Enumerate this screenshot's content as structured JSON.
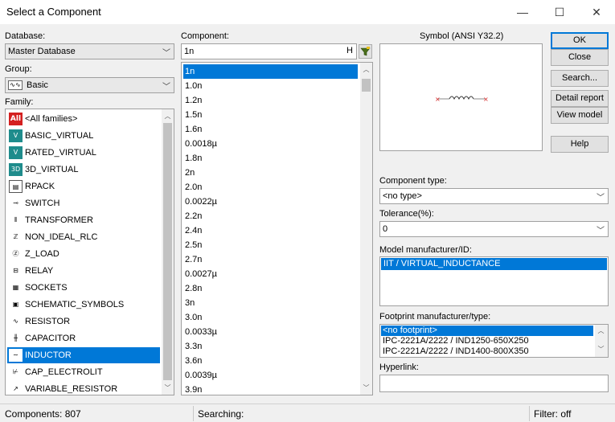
{
  "window": {
    "title": "Select a Component",
    "minimize": "—",
    "maximize": "☐",
    "close": "✕"
  },
  "database": {
    "label": "Database:",
    "value": "Master Database"
  },
  "group": {
    "label": "Group:",
    "value": "Basic"
  },
  "family": {
    "label": "Family:",
    "items": [
      {
        "label": "<All families>",
        "icon": "All"
      },
      {
        "label": "BASIC_VIRTUAL",
        "icon": "V"
      },
      {
        "label": "RATED_VIRTUAL",
        "icon": "V"
      },
      {
        "label": "3D_VIRTUAL",
        "icon": "3D"
      },
      {
        "label": "RPACK",
        "icon": "▤"
      },
      {
        "label": "SWITCH",
        "icon": "⊸"
      },
      {
        "label": "TRANSFORMER",
        "icon": "⫴"
      },
      {
        "label": "NON_IDEAL_RLC",
        "icon": "ℤ"
      },
      {
        "label": "Z_LOAD",
        "icon": "Ⓩ"
      },
      {
        "label": "RELAY",
        "icon": "⊟"
      },
      {
        "label": "SOCKETS",
        "icon": "▦"
      },
      {
        "label": "SCHEMATIC_SYMBOLS",
        "icon": "▣"
      },
      {
        "label": "RESISTOR",
        "icon": "∿"
      },
      {
        "label": "CAPACITOR",
        "icon": "╫"
      },
      {
        "label": "INDUCTOR",
        "icon": "∼"
      },
      {
        "label": "CAP_ELECTROLIT",
        "icon": "⊬"
      },
      {
        "label": "VARIABLE_RESISTOR",
        "icon": "↗"
      }
    ],
    "selected_index": 14
  },
  "component": {
    "label": "Component:",
    "search_value": "1n",
    "h_button": "H",
    "filter_icon": "filter-icon",
    "items": [
      "1n",
      "1.0n",
      "1.2n",
      "1.5n",
      "1.6n",
      "0.0018µ",
      "1.8n",
      "2n",
      "2.0n",
      "0.0022µ",
      "2.2n",
      "2.4n",
      "2.5n",
      "2.7n",
      "0.0027µ",
      "2.8n",
      "3n",
      "3.0n",
      "0.0033µ",
      "3.3n",
      "3.6n",
      "0.0039µ",
      "3.9n"
    ],
    "selected_index": 0
  },
  "symbol": {
    "label": "Symbol (ANSI Y32.2)"
  },
  "buttons": {
    "ok": "OK",
    "close": "Close",
    "search": "Search...",
    "detail_report": "Detail report",
    "view_model": "View model",
    "help": "Help"
  },
  "component_type": {
    "label": "Component type:",
    "value": "<no type>"
  },
  "tolerance": {
    "label": "Tolerance(%):",
    "value": "0"
  },
  "model_manufacturer": {
    "label": "Model manufacturer/ID:",
    "items": [
      "IIT / VIRTUAL_INDUCTANCE"
    ],
    "selected_index": 0
  },
  "footprint": {
    "label": "Footprint manufacturer/type:",
    "items": [
      "<no footprint>",
      "IPC-2221A/2222 / IND1250-650X250",
      "IPC-2221A/2222 / IND1400-800X350"
    ],
    "selected_index": 0
  },
  "hyperlink": {
    "label": "Hyperlink:",
    "value": ""
  },
  "status": {
    "components": "Components: 807",
    "searching": "Searching:",
    "filter": "Filter: off"
  },
  "colors": {
    "selection": "#0078d7",
    "accent_red": "#d42020",
    "teal": "#1f8c8c"
  }
}
